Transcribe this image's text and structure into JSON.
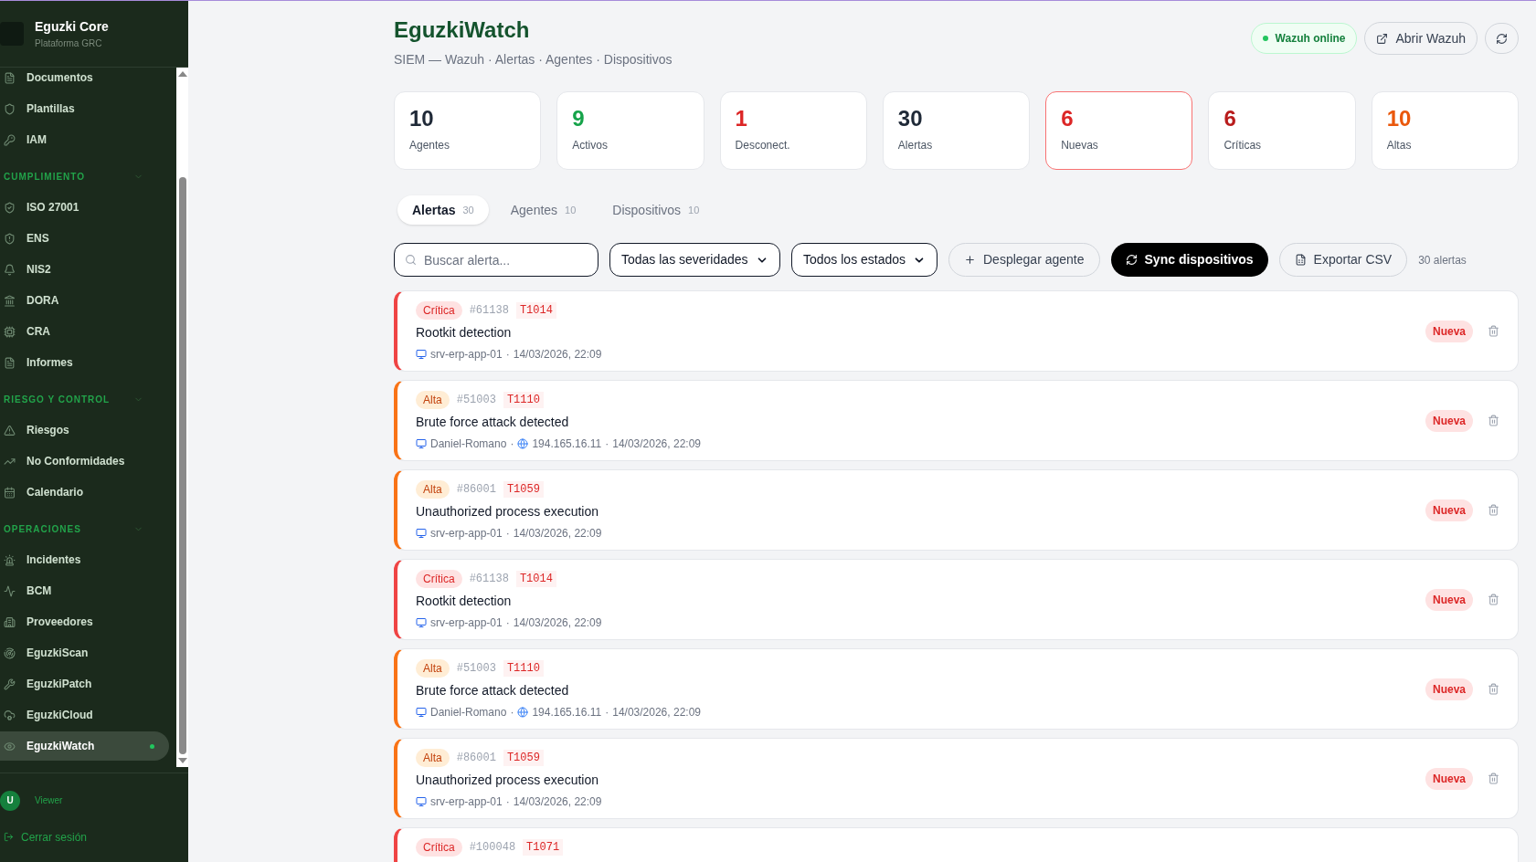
{
  "brand": {
    "title": "Eguzki Core",
    "subtitle": "Plataforma GRC"
  },
  "sidebar": {
    "sections": [
      {
        "items": [
          {
            "label": "Documentos",
            "selected": false
          },
          {
            "label": "Plantillas",
            "selected": false
          },
          {
            "label": "IAM",
            "selected": false
          }
        ]
      },
      {
        "label": "CUMPLIMIENTO",
        "expanded": true,
        "items": [
          {
            "label": "ISO 27001",
            "selected": false
          },
          {
            "label": "ENS",
            "selected": false
          },
          {
            "label": "NIS2",
            "selected": false
          },
          {
            "label": "DORA",
            "selected": false
          },
          {
            "label": "CRA",
            "selected": false
          },
          {
            "label": "Informes",
            "selected": false
          }
        ]
      },
      {
        "label": "RIESGO Y CONTROL",
        "expanded": true,
        "items": [
          {
            "label": "Riesgos",
            "selected": false
          },
          {
            "label": "No Conformidades",
            "selected": false
          },
          {
            "label": "Calendario",
            "selected": false
          }
        ]
      },
      {
        "label": "OPERACIONES",
        "expanded": true,
        "items": [
          {
            "label": "Incidentes",
            "selected": false
          },
          {
            "label": "BCM",
            "selected": false
          },
          {
            "label": "Proveedores",
            "selected": false
          },
          {
            "label": "EguzkiScan",
            "selected": false
          },
          {
            "label": "EguzkiPatch",
            "selected": false
          },
          {
            "label": "EguzkiCloud",
            "selected": false
          },
          {
            "label": "EguzkiWatch",
            "selected": true
          }
        ]
      }
    ],
    "user": {
      "initial": "U",
      "role": "Viewer"
    },
    "logout": "Cerrar sesión"
  },
  "header": {
    "title": "EguzkiWatch",
    "subtitle": "SIEM — Wazuh · Alertas · Agentes · Dispositivos",
    "status": "Wazuh online",
    "open_button": "Abrir Wazuh"
  },
  "stats": [
    {
      "value": "10",
      "label": "Agentes",
      "color": "#1f2937",
      "highlighted": false
    },
    {
      "value": "9",
      "label": "Activos",
      "color": "#16a34a",
      "highlighted": false
    },
    {
      "value": "1",
      "label": "Desconect.",
      "color": "#dc2626",
      "highlighted": false
    },
    {
      "value": "30",
      "label": "Alertas",
      "color": "#1f2937",
      "highlighted": false
    },
    {
      "value": "6",
      "label": "Nuevas",
      "color": "#dc2626",
      "highlighted": true
    },
    {
      "value": "6",
      "label": "Críticas",
      "color": "#b91c1c",
      "highlighted": false
    },
    {
      "value": "10",
      "label": "Altas",
      "color": "#ea580c",
      "highlighted": false
    }
  ],
  "tabs": [
    {
      "label": "Alertas",
      "count": "30",
      "selected": true
    },
    {
      "label": "Agentes",
      "count": "10",
      "selected": false
    },
    {
      "label": "Dispositivos",
      "count": "10",
      "selected": false
    }
  ],
  "toolbar": {
    "search_placeholder": "Buscar alerta...",
    "severity_filter": "Todas las severidades",
    "status_filter": "Todos los estados",
    "deploy_button": "Desplegar agente",
    "sync_button": "Sync dispositivos",
    "export_button": "Exportar CSV",
    "count": "30 alertas"
  },
  "alerts": [
    {
      "kind": "critica",
      "severity": "Crítica",
      "rule": "#61138",
      "technique": "T1014",
      "title": "Rootkit detection",
      "host": "srv-erp-app-01",
      "time": "14/03/2026, 22:09",
      "status": "Nueva"
    },
    {
      "kind": "alta",
      "severity": "Alta",
      "rule": "#51003",
      "technique": "T1110",
      "title": "Brute force attack detected",
      "host": "Daniel-Romano",
      "ip": "194.165.16.11",
      "time": "14/03/2026, 22:09",
      "status": "Nueva"
    },
    {
      "kind": "alta",
      "severity": "Alta",
      "rule": "#86001",
      "technique": "T1059",
      "title": "Unauthorized process execution",
      "host": "srv-erp-app-01",
      "time": "14/03/2026, 22:09",
      "status": "Nueva"
    },
    {
      "kind": "critica",
      "severity": "Crítica",
      "rule": "#61138",
      "technique": "T1014",
      "title": "Rootkit detection",
      "host": "srv-erp-app-01",
      "time": "14/03/2026, 22:09",
      "status": "Nueva"
    },
    {
      "kind": "alta",
      "severity": "Alta",
      "rule": "#51003",
      "technique": "T1110",
      "title": "Brute force attack detected",
      "host": "Daniel-Romano",
      "ip": "194.165.16.11",
      "time": "14/03/2026, 22:09",
      "status": "Nueva"
    },
    {
      "kind": "alta",
      "severity": "Alta",
      "rule": "#86001",
      "technique": "T1059",
      "title": "Unauthorized process execution",
      "host": "srv-erp-app-01",
      "time": "14/03/2026, 22:09",
      "status": "Nueva"
    },
    {
      "kind": "critica",
      "severity": "Crítica",
      "rule": "#100048",
      "technique": "T1071"
    }
  ],
  "meta_separator": "·"
}
